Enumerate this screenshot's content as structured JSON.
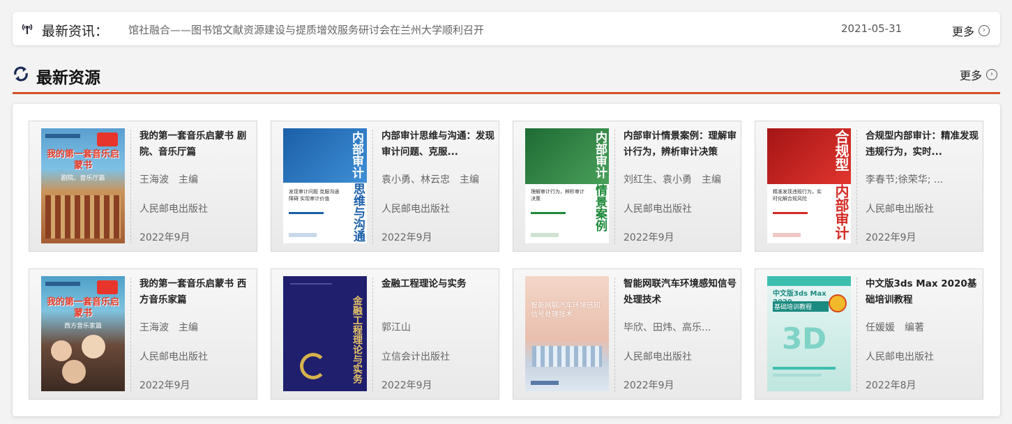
{
  "news": {
    "label": "最新资讯：",
    "title": "馆社融合——图书馆文献资源建设与提质增效服务研讨会在兰州大学顺利召开",
    "date": "2021-05-31",
    "more": "更多"
  },
  "section": {
    "title": "最新资源",
    "more": "更多"
  },
  "books": [
    {
      "title": "我的第一套音乐启蒙书 剧院、音乐厅篇",
      "author": "王海波　主编",
      "publisher": "人民邮电出版社",
      "date": "2022年9月"
    },
    {
      "title": "内部审计思维与沟通：发现审计问题、克服...",
      "author": "袁小勇、林云忠　主编",
      "publisher": "人民邮电出版社",
      "date": "2022年9月"
    },
    {
      "title": "内部审计情景案例：理解审计行为，辨析审计决策",
      "author": "刘红生、袁小勇　主编",
      "publisher": "人民邮电出版社",
      "date": "2022年9月"
    },
    {
      "title": "合规型内部审计：精准发现违规行为，实时...",
      "author": "李春节;徐荣华; ...",
      "publisher": "人民邮电出版社",
      "date": "2022年9月"
    },
    {
      "title": "我的第一套音乐启蒙书 西方音乐家篇",
      "author": "王海波　主编",
      "publisher": "人民邮电出版社",
      "date": "2022年9月"
    },
    {
      "title": "金融工程理论与实务",
      "author": "郭江山",
      "publisher": "立信会计出版社",
      "date": "2022年9月"
    },
    {
      "title": "智能网联汽车环境感知信号处理技术",
      "author": "毕欣、田炜、高乐...",
      "publisher": "人民邮电出版社",
      "date": "2022年9月"
    },
    {
      "title": "中文版3ds Max 2020基础培训教程",
      "author": "任媛媛　编著",
      "publisher": "人民邮电出版社",
      "date": "2022年8月"
    }
  ],
  "covers": [
    {
      "text": "我的第一套音乐启蒙书",
      "sub": "剧院、音乐厅篇"
    },
    {
      "text": "内部审计思维与沟通",
      "sub": "发现审计问题 克服沟通障碍 实现审计价值"
    },
    {
      "text": "内部审计情景案例",
      "sub": "理解审计行为，辨析审计决策"
    },
    {
      "text": "合规型内部审计",
      "sub": "精准发现违规行为，实时化解合规风险"
    },
    {
      "text": "我的第一套音乐启蒙书",
      "sub": "西方音乐家篇"
    },
    {
      "text": "金融工程理论与实务",
      "sub": ""
    },
    {
      "text": "智能网联汽车环境感知信号处理技术",
      "sub": ""
    },
    {
      "text": "中文版3ds Max 2020",
      "sub": "基础培训教程"
    }
  ]
}
